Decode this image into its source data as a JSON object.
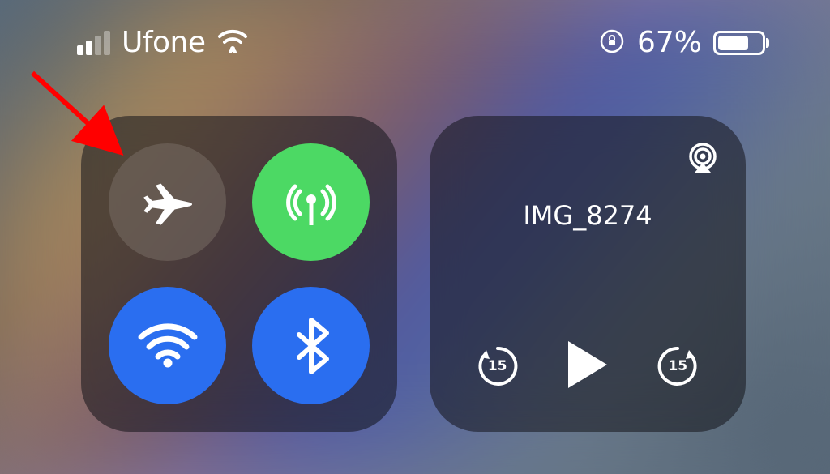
{
  "status_bar": {
    "carrier": "Ufone",
    "battery_percent": "67%"
  },
  "connectivity": {
    "airplane_mode": {
      "enabled": false
    },
    "cellular_data": {
      "enabled": true
    },
    "wifi": {
      "enabled": true
    },
    "bluetooth": {
      "enabled": true
    }
  },
  "media": {
    "title": "IMG_8274",
    "skip_back_label": "15",
    "skip_forward_label": "15"
  },
  "annotation": {
    "arrow_target": "airplane-mode-button"
  },
  "colors": {
    "green": "#4cd964",
    "blue": "#2a6ef0",
    "arrow": "#ff0000"
  }
}
